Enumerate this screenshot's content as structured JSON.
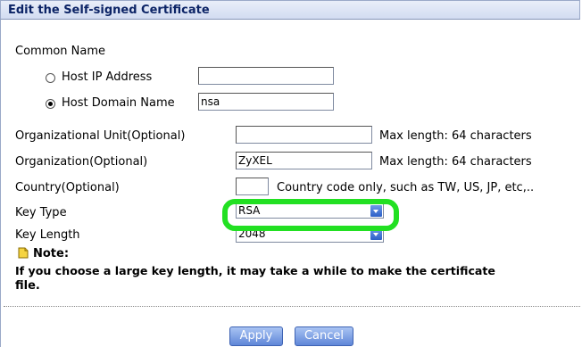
{
  "header": {
    "title": "Edit the Self-signed Certificate"
  },
  "common_name": {
    "label": "Common Name",
    "options": [
      {
        "label": "Host IP Address",
        "selected": false,
        "value": ""
      },
      {
        "label": "Host Domain Name",
        "selected": true,
        "value": "nsa"
      }
    ]
  },
  "fields": {
    "org_unit": {
      "label": "Organizational Unit(Optional)",
      "value": "",
      "hint": "Max length: 64 characters"
    },
    "organization": {
      "label": "Organization(Optional)",
      "value": "ZyXEL",
      "hint": "Max length: 64 characters"
    },
    "country": {
      "label": "Country(Optional)",
      "value": "",
      "hint": "Country code only, such as TW, US, JP, etc,.."
    },
    "key_type": {
      "label": "Key Type",
      "value": "RSA"
    },
    "key_length": {
      "label": "Key Length",
      "value": "2048"
    }
  },
  "note": {
    "title": "Note:",
    "line1": "If you choose a large key length, it may take a while to make the certificate",
    "line2": "file."
  },
  "buttons": {
    "apply": "Apply",
    "cancel": "Cancel"
  },
  "colors": {
    "highlight": "#22e022",
    "header_text": "#0c2466",
    "button": "#5f86d8"
  },
  "icons": {
    "note": "note-icon",
    "select_arrow": "chevron-down-icon"
  }
}
